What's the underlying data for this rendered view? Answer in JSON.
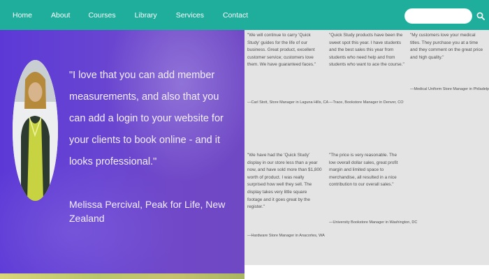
{
  "nav": {
    "items": [
      "Home",
      "About",
      "Courses",
      "Library",
      "Services",
      "Contact"
    ]
  },
  "search": {
    "placeholder": "",
    "value": ""
  },
  "hero": {
    "quote": "\"I love that you can add member measurements, and also that you can add a login to your website for your clients to book online - and it looks professional.\"",
    "author": "Melissa Percival, Peak for Life, New Zealand"
  },
  "testimonials": [
    {
      "text": "\"We will continue to carry 'Quick Study' guides for the life of our business. Great product, excellent customer service; customers love them. We have guaranteed faces.\"",
      "source": "—Carl Stott, Store Manager in Laguna Hills, CA"
    },
    {
      "text": "\"Quick Study products have been the sweet spot this year. I have students and the best sales this year from students who need help and from students who want to ace the course.\"",
      "source": "—Trace, Bookstore Manager in Denver, CO"
    },
    {
      "text": "\"My customers love your medical titles. They purchase you at a time and they comment on the great price and high quality.\"",
      "source": "—Medical Uniform Store Manager in Philadelphia, PA"
    },
    {
      "text": "\"We have had the 'Quick Study' display in our store less than a year now, and have sold more than $1,800 worth of product. I was really surprised how well they sell. The display takes very little square footage and it goes great by the register.\"",
      "source": "—Hardware Store Manager in Anacortes, WA"
    },
    {
      "text": "\"The price is very reasonable. The low overall dollar sales, great profit margin and limited space to merchandise, all resulted in a nice contribution to our overall sales.\"",
      "source": "—University Bookstore Manager in Washington, DC"
    }
  ],
  "colors": {
    "nav_bg": "#1fae9b",
    "hero_bg": "#6844d2",
    "testimonial_bg": "#e4e4e4"
  },
  "icons": {
    "search": "search-icon",
    "avatar": "avatar"
  }
}
